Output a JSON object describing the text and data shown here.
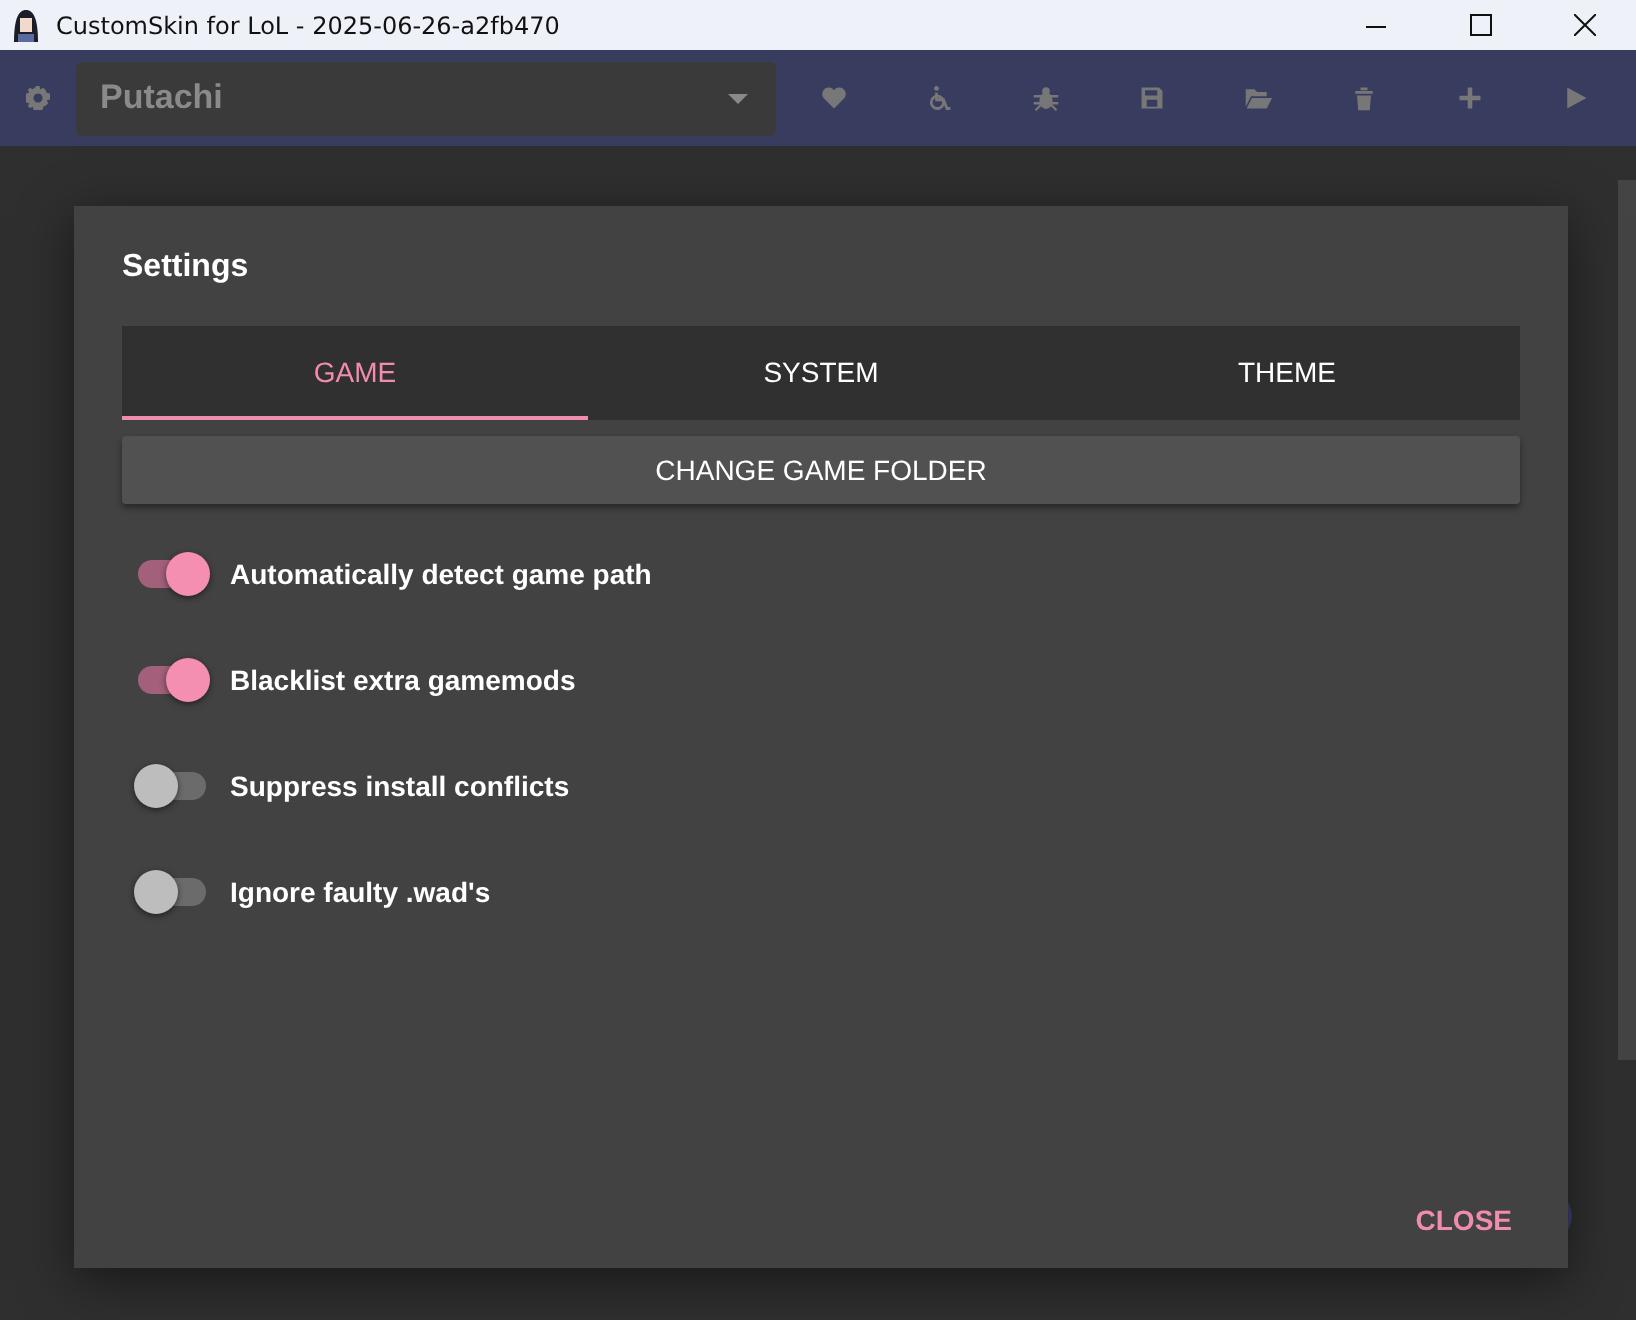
{
  "window": {
    "title": "CustomSkin for LoL - 2025-06-26-a2fb470"
  },
  "toolbar": {
    "profile": "Putachi"
  },
  "dialog": {
    "title": "Settings",
    "tabs": [
      {
        "label": "GAME",
        "selected": true
      },
      {
        "label": "SYSTEM",
        "selected": false
      },
      {
        "label": "THEME",
        "selected": false
      }
    ],
    "button": "CHANGE GAME FOLDER",
    "toggles": [
      {
        "label": "Automatically detect game path",
        "on": true
      },
      {
        "label": "Blacklist extra gamemods",
        "on": true
      },
      {
        "label": "Suppress install conflicts",
        "on": false
      },
      {
        "label": "Ignore faulty .wad's",
        "on": false
      }
    ],
    "close": "CLOSE"
  }
}
